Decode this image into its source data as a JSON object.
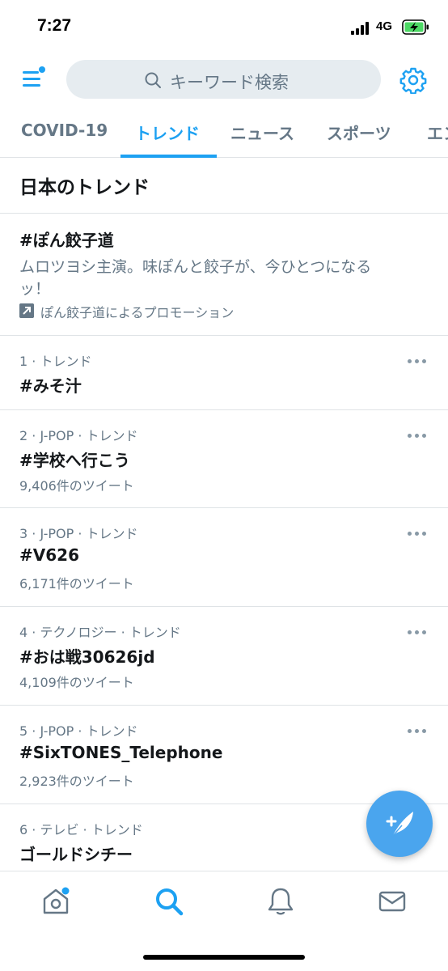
{
  "status_bar": {
    "time": "7:27",
    "network": "4G"
  },
  "header": {
    "search_placeholder": "キーワード検索"
  },
  "tabs": [
    {
      "label": "COVID-19",
      "active": false
    },
    {
      "label": "トレンド",
      "active": true
    },
    {
      "label": "ニュース",
      "active": false
    },
    {
      "label": "スポーツ",
      "active": false
    },
    {
      "label": "エン",
      "active": false
    }
  ],
  "section": {
    "title": "日本のトレンド"
  },
  "promoted": {
    "title": "#ぽん餃子道",
    "description": "ムロツヨシ主演。味ぽんと餃子が、今ひとつになるッ！",
    "by": "ぽん餃子道によるプロモーション"
  },
  "trends": [
    {
      "meta": "1 · トレンド",
      "name": "#みそ汁",
      "count": ""
    },
    {
      "meta": "2 · J-POP · トレンド",
      "name": "#学校へ行こう",
      "count": "9,406件のツイート"
    },
    {
      "meta": "3 · J-POP · トレンド",
      "name": "#V626",
      "count": "6,171件のツイート"
    },
    {
      "meta": "4 · テクノロジー · トレンド",
      "name": "#おは戦30626jd",
      "count": "4,109件のツイート"
    },
    {
      "meta": "5 · J-POP · トレンド",
      "name": "#SixTONES_Telephone",
      "count": "2,923件のツイート"
    },
    {
      "meta": "6 · テレビ · トレンド",
      "name": "ゴールドシチー",
      "count": ""
    }
  ],
  "colors": {
    "accent": "#1da1f2",
    "secondary_text": "#657786",
    "fab": "#4aa5ee"
  },
  "nav": {
    "items": [
      "home-icon",
      "search-icon",
      "notifications-bell-icon",
      "messages-mail-icon"
    ],
    "active": "search-icon"
  }
}
